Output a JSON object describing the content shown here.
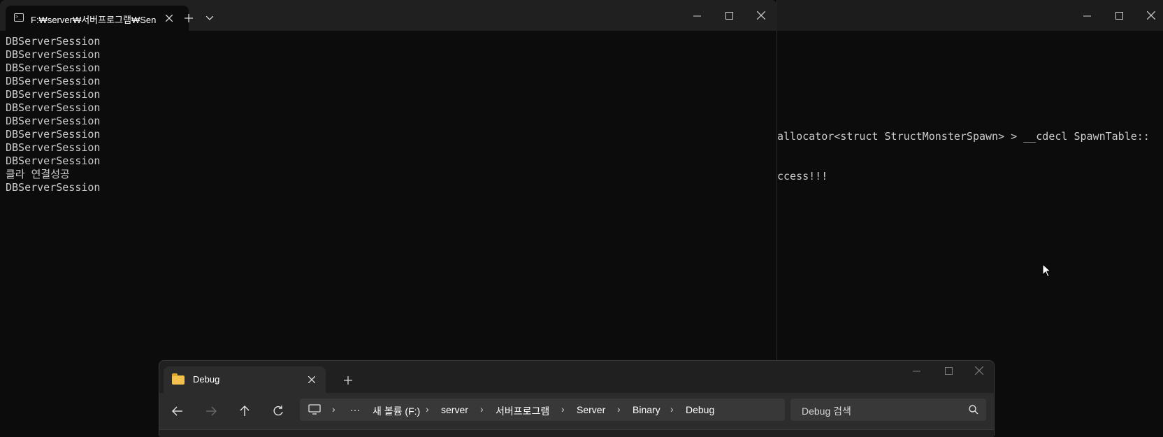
{
  "background_terminal": {
    "lines": [
      "allocator<struct StructMonsterSpawn> > __cdecl SpawnTable::",
      "ccess!!!"
    ]
  },
  "terminal": {
    "tab_title": "F:₩server₩서버프로그램₩Sen",
    "tab_icon": "terminal-icon",
    "output_lines": [
      "DBServerSession",
      "DBServerSession",
      "DBServerSession",
      "DBServerSession",
      "DBServerSession",
      "DBServerSession",
      "DBServerSession",
      "DBServerSession",
      "DBServerSession",
      "DBServerSession",
      "클라 연결성공",
      "DBServerSession"
    ]
  },
  "explorer": {
    "tab_title": "Debug",
    "breadcrumbs": [
      "새 볼륨 (F:)",
      "server",
      "서버프로그램",
      "Server",
      "Binary",
      "Debug"
    ],
    "search_placeholder": "Debug 검색",
    "more_label": "···"
  },
  "colors": {
    "terminal_bg": "#0c0c0c",
    "titlebar_bg": "#202020",
    "text": "#cccccc",
    "folder": "#f2c14e"
  }
}
